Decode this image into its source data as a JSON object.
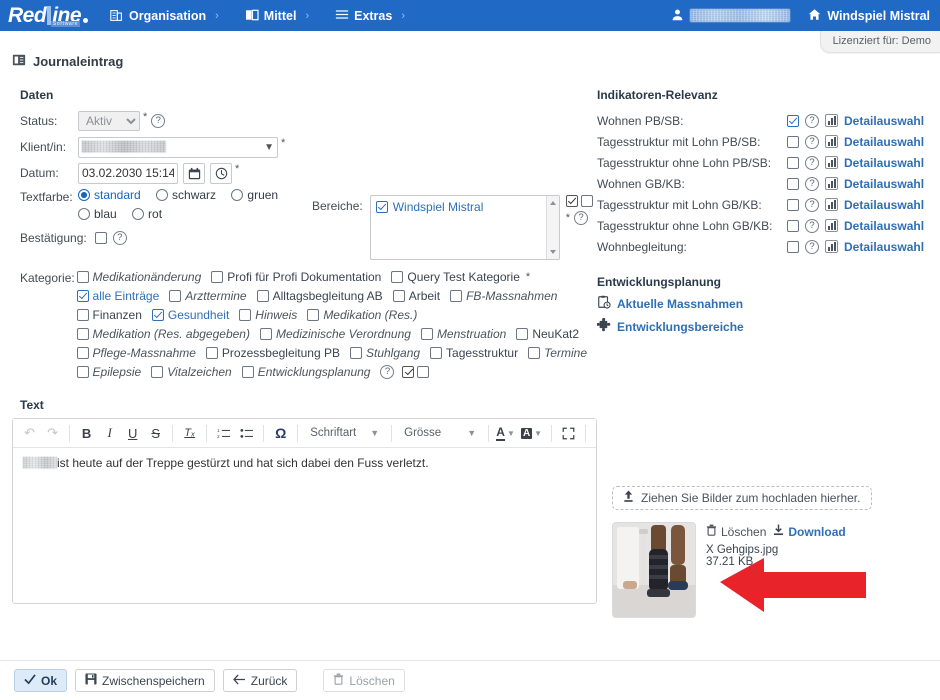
{
  "header": {
    "logo": {
      "part1": "Red",
      "part2": "ine",
      "sub": "Software"
    },
    "nav": [
      {
        "label": "Organisation",
        "icon": "building-icon",
        "chevron": "›"
      },
      {
        "label": "Mittel",
        "icon": "book-icon",
        "chevron": "›"
      },
      {
        "label": "Extras",
        "icon": "hamburger-icon",
        "chevron": "›"
      }
    ],
    "user_name_redacted": "",
    "home_label": "Windspiel Mistral",
    "license": "Lizenziert für: Demo"
  },
  "page": {
    "title": "Journaleintrag"
  },
  "daten": {
    "section_title": "Daten",
    "status": {
      "label": "Status:",
      "value": "Aktiv",
      "required": "*"
    },
    "klient": {
      "label": "Klient/in:",
      "value_redacted": "",
      "required": "*"
    },
    "datum": {
      "label": "Datum:",
      "value": "03.02.2030 15:14",
      "required": "*",
      "calendar_icon": "calendar-icon",
      "clock_icon": "clock-icon"
    },
    "textfarbe": {
      "label": "Textfarbe:",
      "options": [
        {
          "label": "standard",
          "selected": true
        },
        {
          "label": "schwarz",
          "selected": false
        },
        {
          "label": "gruen",
          "selected": false
        },
        {
          "label": "blau",
          "selected": false
        },
        {
          "label": "rot",
          "selected": false
        }
      ]
    },
    "bestaetigung": {
      "label": "Bestätigung:",
      "checked": false
    }
  },
  "bereiche": {
    "label": "Bereiche:",
    "items": [
      {
        "label": "Windspiel Mistral",
        "checked": true
      }
    ],
    "required": "*",
    "select_all_checked": true,
    "deselect_all_checked": false
  },
  "kategorie": {
    "label": "Kategorie:",
    "rows": [
      [
        {
          "label": "Medikationänderung",
          "checked": false,
          "italic": true
        },
        {
          "label": "Profi für Profi Dokumentation",
          "checked": false,
          "italic": false
        },
        {
          "label": "Query Test Kategorie",
          "checked": false,
          "italic": false,
          "required": "*"
        }
      ],
      [
        {
          "label": "alle Einträge",
          "checked": true,
          "italic": false
        },
        {
          "label": "Arzttermine",
          "checked": false,
          "italic": true
        },
        {
          "label": "Alltagsbegleitung AB",
          "checked": false,
          "italic": false
        },
        {
          "label": "Arbeit",
          "checked": false,
          "italic": false
        },
        {
          "label": "FB-Massnahmen",
          "checked": false,
          "italic": true
        }
      ],
      [
        {
          "label": "Finanzen",
          "checked": false,
          "italic": false
        },
        {
          "label": "Gesundheit",
          "checked": true,
          "italic": false
        },
        {
          "label": "Hinweis",
          "checked": false,
          "italic": true
        },
        {
          "label": "Medikation (Res.)",
          "checked": false,
          "italic": true
        }
      ],
      [
        {
          "label": "Medikation (Res. abgegeben)",
          "checked": false,
          "italic": true
        },
        {
          "label": "Medizinische Verordnung",
          "checked": false,
          "italic": true
        },
        {
          "label": "Menstruation",
          "checked": false,
          "italic": true
        },
        {
          "label": "NeuKat2",
          "checked": false,
          "italic": false
        }
      ],
      [
        {
          "label": "Pflege-Massnahme",
          "checked": false,
          "italic": true
        },
        {
          "label": "Prozessbegleitung PB",
          "checked": false,
          "italic": false
        },
        {
          "label": "Stuhlgang",
          "checked": false,
          "italic": true
        },
        {
          "label": "Tagesstruktur",
          "checked": false,
          "italic": false
        },
        {
          "label": "Termine",
          "checked": false,
          "italic": true
        }
      ],
      [
        {
          "label": "Epilepsie",
          "checked": false,
          "italic": true
        },
        {
          "label": "Vitalzeichen",
          "checked": false,
          "italic": true
        },
        {
          "label": "Entwicklungsplanung",
          "checked": false,
          "italic": true
        }
      ]
    ],
    "select_all_checked": true,
    "deselect_all_checked": false
  },
  "indikatoren": {
    "section_title": "Indikatoren-Relevanz",
    "detail_label": "Detailauswahl",
    "rows": [
      {
        "label": "Wohnen PB/SB:",
        "checked": true
      },
      {
        "label": "Tagesstruktur mit Lohn PB/SB:",
        "checked": false
      },
      {
        "label": "Tagesstruktur ohne Lohn PB/SB:",
        "checked": false
      },
      {
        "label": "Wohnen GB/KB:",
        "checked": false
      },
      {
        "label": "Tagesstruktur mit Lohn GB/KB:",
        "checked": false
      },
      {
        "label": "Tagesstruktur ohne Lohn GB/KB:",
        "checked": false
      },
      {
        "label": "Wohnbegleitung:",
        "checked": false
      }
    ]
  },
  "entwicklungsplanung": {
    "section_title": "Entwicklungsplanung",
    "links": [
      {
        "label": "Aktuelle Massnahmen",
        "icon": "clipboard-clock-icon"
      },
      {
        "label": "Entwicklungsbereiche",
        "icon": "puzzle-icon"
      }
    ]
  },
  "text": {
    "section_title": "Text",
    "toolbar": {
      "undo": "↶",
      "redo": "↷",
      "bold": "B",
      "italic": "I",
      "underline": "U",
      "strike": "S",
      "clear_format": "Tₓ",
      "numbered_list": "numbered-list-icon",
      "bullet_list": "bullet-list-icon",
      "omega": "Ω",
      "font_family": "Schriftart",
      "font_size": "Grösse",
      "text_color": "A",
      "bg_color": "A",
      "fullscreen": "fullscreen-icon"
    },
    "body_redacted_prefix": "",
    "body": "ist heute auf der Treppe gestürzt und hat sich dabei den Fuss verletzt."
  },
  "upload": {
    "dropzone": "Ziehen Sie Bilder zum hochladen hierher.",
    "dropzone_icon": "upload-icon",
    "file": {
      "delete_label": "Löschen",
      "download_label": "Download",
      "name": "X Gehgips.jpg",
      "size": "37.21 KB",
      "thumb_alt": "leg-cast-photo"
    }
  },
  "footer": {
    "buttons": [
      {
        "label": "Ok",
        "icon": "check-icon",
        "style": "primary"
      },
      {
        "label": "Zwischenspeichern",
        "icon": "save-icon",
        "style": "normal"
      },
      {
        "label": "Zurück",
        "icon": "arrow-left-icon",
        "style": "normal"
      },
      {
        "label": "Löschen",
        "icon": "trash-icon",
        "style": "ghost"
      }
    ]
  },
  "colors": {
    "header_blue": "#2069c4",
    "link_blue": "#2f6fb5",
    "accent_check": "#2f6fb5",
    "arrow_red": "#e8232a"
  }
}
